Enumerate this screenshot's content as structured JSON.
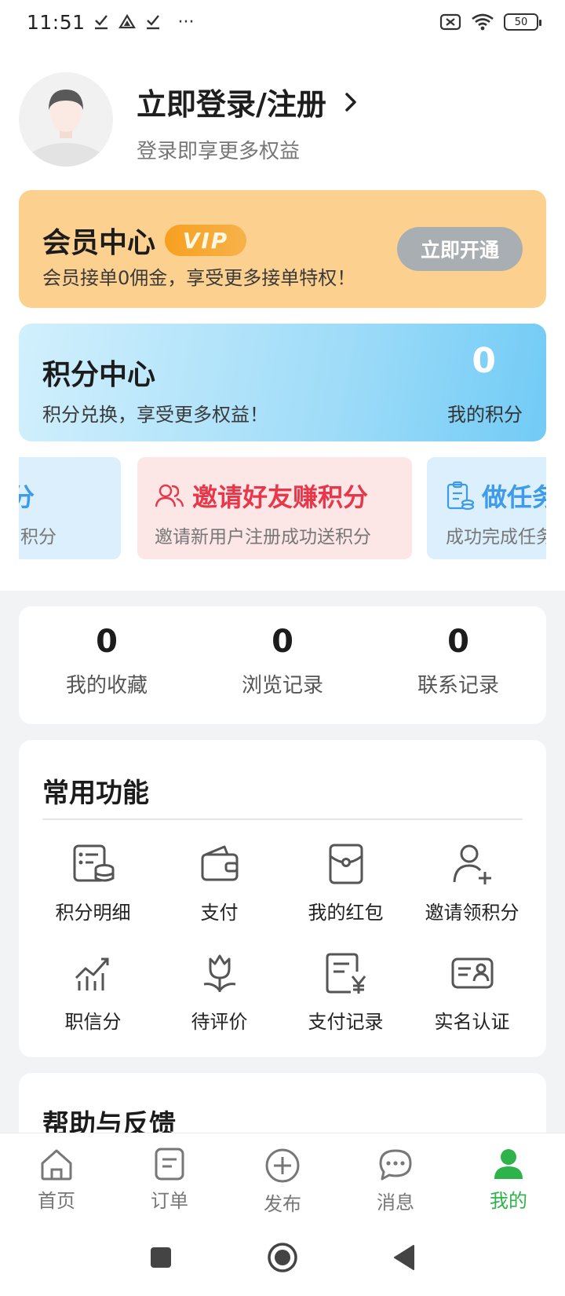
{
  "status_bar": {
    "time": "11:51",
    "more": "···",
    "battery": "50"
  },
  "profile": {
    "title": "立即登录/注册",
    "subtitle": "登录即享更多权益"
  },
  "vip": {
    "title": "会员中心",
    "badge": "VIP",
    "desc": "会员接单0佣金，享受更多接单特权！",
    "button": "立即开通"
  },
  "points": {
    "title": "积分中心",
    "desc": "积分兑换，享受更多权益！",
    "value": "0",
    "label": "我的积分"
  },
  "promos": [
    {
      "title": "分",
      "desc": "积分"
    },
    {
      "title": "邀请好友赚积分",
      "desc": "邀请新用户注册成功送积分"
    },
    {
      "title": "做任务",
      "desc": "成功完成任务"
    }
  ],
  "stats": [
    {
      "value": "0",
      "label": "我的收藏"
    },
    {
      "value": "0",
      "label": "浏览记录"
    },
    {
      "value": "0",
      "label": "联系记录"
    }
  ],
  "functions": {
    "title": "常用功能",
    "items": [
      {
        "label": "积分明细",
        "icon": "points-detail-icon"
      },
      {
        "label": "支付",
        "icon": "wallet-icon"
      },
      {
        "label": "我的红包",
        "icon": "red-packet-icon"
      },
      {
        "label": "邀请领积分",
        "icon": "invite-user-icon"
      },
      {
        "label": "职信分",
        "icon": "credit-chart-icon"
      },
      {
        "label": "待评价",
        "icon": "tulip-icon"
      },
      {
        "label": "支付记录",
        "icon": "payment-record-icon"
      },
      {
        "label": "实名认证",
        "icon": "id-card-icon"
      }
    ]
  },
  "help": {
    "title": "帮助与反馈"
  },
  "tabs": [
    {
      "label": "首页",
      "icon": "home-icon"
    },
    {
      "label": "订单",
      "icon": "order-icon"
    },
    {
      "label": "发布",
      "icon": "publish-plus-icon"
    },
    {
      "label": "消息",
      "icon": "message-icon"
    },
    {
      "label": "我的",
      "icon": "user-icon",
      "active": true
    }
  ],
  "colors": {
    "accent_green": "#2db34a",
    "vip_bg": "#fcd08f",
    "invite_red": "#e8364a",
    "task_blue": "#3d9be9"
  }
}
